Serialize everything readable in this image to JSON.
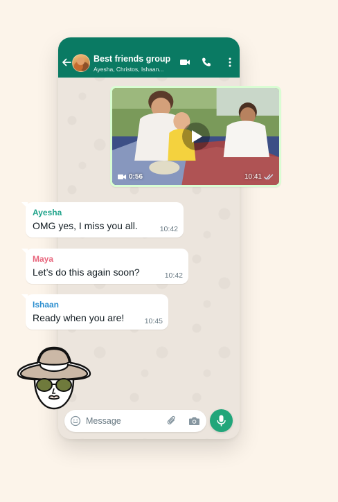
{
  "header": {
    "title": "Best friends group",
    "subtitle": "Ayesha, Christos, Ishaan..."
  },
  "video_message": {
    "duration": "0:56",
    "time": "10:41",
    "status": "read"
  },
  "messages": [
    {
      "sender": "Ayesha",
      "sender_color": "#1fa38a",
      "text": "OMG yes, I miss you all.",
      "time": "10:42"
    },
    {
      "sender": "Maya",
      "sender_color": "#e8667d",
      "text": "Let’s do this again soon?",
      "time": "10:42"
    },
    {
      "sender": "Ishaan",
      "sender_color": "#2c8ecf",
      "text": "Ready when you are!",
      "time": "10:45"
    }
  ],
  "composer": {
    "placeholder": "Message"
  },
  "colors": {
    "header": "#0a7a63",
    "accent": "#21a67a",
    "outgoing_bubble": "#d9fdd3",
    "background": "#fcf4ea"
  },
  "icons": [
    "back-arrow-icon",
    "video-call-icon",
    "phone-call-icon",
    "more-menu-icon",
    "play-icon",
    "video-camera-icon",
    "double-check-icon",
    "emoji-icon",
    "attach-icon",
    "camera-icon",
    "mic-icon"
  ]
}
